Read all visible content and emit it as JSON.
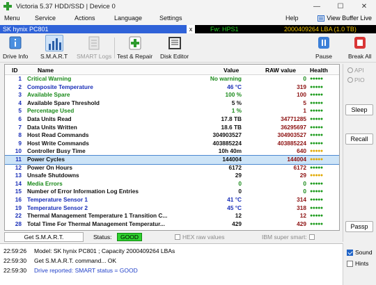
{
  "window": {
    "title": "Victoria 5.37 HDD/SSD | Device 0"
  },
  "menu": {
    "items": [
      "Menu",
      "Service",
      "Actions",
      "Language",
      "Settings",
      "Help"
    ],
    "view_buffer": "View Buffer Live"
  },
  "device": {
    "name": "SK hynix PC801",
    "close": "x",
    "firmware": "Fw: HPS1",
    "lba": "2000409264 LBA (1.0 TB)"
  },
  "toolbar": {
    "drive_info": "Drive Info",
    "smart": "S.M.A.R.T",
    "smart_logs": "SMART Logs",
    "test_repair": "Test & Repair",
    "disk_editor": "Disk Editor",
    "pause": "Pause",
    "break_all": "Break All"
  },
  "grid": {
    "headers": {
      "id": "ID",
      "name": "Name",
      "value": "Value",
      "raw": "RAW value",
      "health": "Health"
    },
    "rows": [
      {
        "id": "1",
        "name": "Critical Warning",
        "value": "No warning",
        "raw": "0",
        "health": "●●●●●",
        "name_color": "#1a8a1a",
        "value_color": "#1a8a1a",
        "health_color": "#1a9a1a",
        "raw_color": "#1a8a1a"
      },
      {
        "id": "2",
        "name": "Composite Temperature",
        "value": "46 °C",
        "raw": "319",
        "health": "●●●●●",
        "name_color": "#1a2fb8",
        "value_color": "#1a2fb8",
        "health_color": "#1a9a1a",
        "raw_color": "#8c1010"
      },
      {
        "id": "3",
        "name": "Available Spare",
        "value": "100 %",
        "raw": "100",
        "health": "●●●●●",
        "name_color": "#1a8a1a",
        "value_color": "#1a8a1a",
        "health_color": "#1a9a1a",
        "raw_color": "#8c1010"
      },
      {
        "id": "4",
        "name": "Available Spare Threshold",
        "value": "5 %",
        "raw": "5",
        "health": "●●●●●",
        "name_color": "#111111",
        "value_color": "#111111",
        "health_color": "#1a9a1a",
        "raw_color": "#8c1010"
      },
      {
        "id": "5",
        "name": "Percentage Used",
        "value": "1 %",
        "raw": "1",
        "health": "●●●●●",
        "name_color": "#1a8a1a",
        "value_color": "#1a8a1a",
        "health_color": "#1a9a1a",
        "raw_color": "#8c1010"
      },
      {
        "id": "6",
        "name": "Data Units Read",
        "value": "17.8 TB",
        "raw": "34771285",
        "health": "●●●●●",
        "name_color": "#111111",
        "value_color": "#111111",
        "health_color": "#1a9a1a",
        "raw_color": "#8c1010"
      },
      {
        "id": "7",
        "name": "Data Units Written",
        "value": "18.6 TB",
        "raw": "36295697",
        "health": "●●●●●",
        "name_color": "#111111",
        "value_color": "#111111",
        "health_color": "#1a9a1a",
        "raw_color": "#8c1010"
      },
      {
        "id": "8",
        "name": "Host Read Commands",
        "value": "304903527",
        "raw": "304903527",
        "health": "●●●●●",
        "name_color": "#111111",
        "value_color": "#111111",
        "health_color": "#1a9a1a",
        "raw_color": "#8c1010"
      },
      {
        "id": "9",
        "name": "Host Write Commands",
        "value": "403885224",
        "raw": "403885224",
        "health": "●●●●●",
        "name_color": "#111111",
        "value_color": "#111111",
        "health_color": "#1a9a1a",
        "raw_color": "#8c1010"
      },
      {
        "id": "10",
        "name": "Controller Busy Time",
        "value": "10h 40m",
        "raw": "640",
        "health": "●●●●●",
        "name_color": "#111111",
        "value_color": "#111111",
        "health_color": "#e0a800",
        "raw_color": "#8c1010"
      },
      {
        "id": "11",
        "name": "Power Cycles",
        "value": "144004",
        "raw": "144004",
        "health": "●●●●●",
        "name_color": "#111111",
        "value_color": "#111111",
        "health_color": "#e0a800",
        "raw_color": "#8c1010"
      },
      {
        "id": "12",
        "name": "Power On Hours",
        "value": "6172",
        "raw": "6172",
        "health": "●●●●●",
        "name_color": "#111111",
        "value_color": "#111111",
        "health_color": "#1a9a1a",
        "raw_color": "#8c1010"
      },
      {
        "id": "13",
        "name": "Unsafe Shutdowns",
        "value": "29",
        "raw": "29",
        "health": "●●●●●",
        "name_color": "#111111",
        "value_color": "#111111",
        "health_color": "#e0a800",
        "raw_color": "#8c1010"
      },
      {
        "id": "14",
        "name": "Media Errors",
        "value": "0",
        "raw": "0",
        "health": "●●●●●",
        "name_color": "#1a8a1a",
        "value_color": "#1a8a1a",
        "health_color": "#1a9a1a",
        "raw_color": "#1a8a1a"
      },
      {
        "id": "15",
        "name": "Number of Error Information Log Entries",
        "value": "0",
        "raw": "0",
        "health": "●●●●●",
        "name_color": "#111111",
        "value_color": "#111111",
        "health_color": "#1a9a1a",
        "raw_color": "#1a8a1a"
      },
      {
        "id": "16",
        "name": "Temperature Sensor 1",
        "value": "41 °C",
        "raw": "314",
        "health": "●●●●●",
        "name_color": "#1a2fb8",
        "value_color": "#1a2fb8",
        "health_color": "#1a9a1a",
        "raw_color": "#8c1010"
      },
      {
        "id": "19",
        "name": "Temperature Sensor 2",
        "value": "45 °C",
        "raw": "318",
        "health": "●●●●●",
        "name_color": "#1a2fb8",
        "value_color": "#1a2fb8",
        "health_color": "#1a9a1a",
        "raw_color": "#8c1010"
      },
      {
        "id": "22",
        "name": "Thermal Management Temperature 1 Transition C...",
        "value": "12",
        "raw": "12",
        "health": "●●●●●",
        "name_color": "#111111",
        "value_color": "#111111",
        "health_color": "#1a9a1a",
        "raw_color": "#8c1010"
      },
      {
        "id": "28",
        "name": "Total Time For Thermal Management Temperatur...",
        "value": "429",
        "raw": "429",
        "health": "●●●●●",
        "name_color": "#111111",
        "value_color": "#111111",
        "health_color": "#1a9a1a",
        "raw_color": "#8c1010"
      }
    ],
    "selected_row": 10
  },
  "side": {
    "api": "API",
    "pio": "PIO",
    "sleep": "Sleep",
    "recall": "Recall",
    "passp": "Passp"
  },
  "status": {
    "get_smart": "Get S.M.A.R.T.",
    "label": "Status:",
    "value": "GOOD",
    "hex": "HEX raw values",
    "ibm": "IBM super smart:"
  },
  "log": {
    "lines": [
      {
        "time": "22:59:26",
        "text": "Model: SK hynix PC801                    ; Capacity 2000409264 LBAs",
        "color": "#111111"
      },
      {
        "time": "22:59:30",
        "text": "Get S.M.A.R.T. command... OK",
        "color": "#111111"
      },
      {
        "time": "22:59:30",
        "text": "Drive reported: SMART status = GOOD",
        "color": "#1f3fc8"
      }
    ],
    "sound": "Sound",
    "hints": "Hints"
  },
  "colors": {
    "accent": "#2f62d8",
    "good": "#2fd12f"
  }
}
